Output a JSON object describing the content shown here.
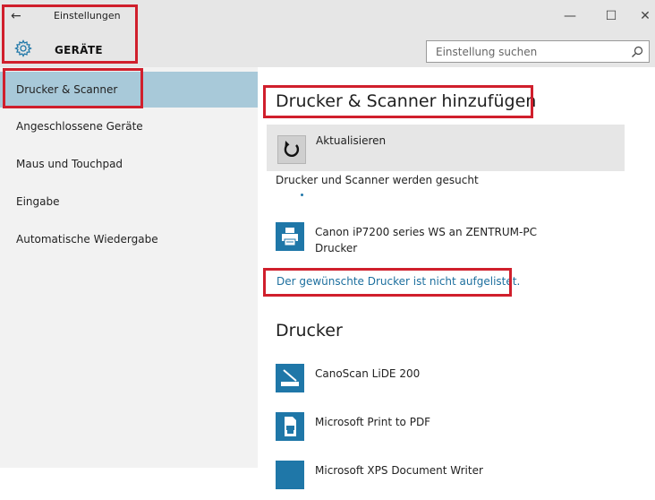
{
  "window": {
    "title": "Einstellungen",
    "back_glyph": "←",
    "minimize_glyph": "—",
    "maximize_glyph": "☐",
    "close_glyph": "✕"
  },
  "header": {
    "section_title": "GERÄTE",
    "search_placeholder": "Einstellung suchen"
  },
  "sidebar": {
    "items": [
      {
        "label": "Drucker & Scanner",
        "active": true
      },
      {
        "label": "Angeschlossene Geräte",
        "active": false
      },
      {
        "label": "Maus und Touchpad",
        "active": false
      },
      {
        "label": "Eingabe",
        "active": false
      },
      {
        "label": "Automatische Wiedergabe",
        "active": false
      }
    ]
  },
  "main": {
    "heading": "Drucker & Scanner hinzufügen",
    "refresh_label": "Aktualisieren",
    "searching_text": "Drucker und Scanner werden gesucht",
    "found_device": {
      "name": "Canon iP7200 series WS an ZENTRUM-PC",
      "type": "Drucker"
    },
    "not_listed_link": "Der gewünschte Drucker ist nicht aufgelistet.",
    "printers_heading": "Drucker",
    "printers": [
      {
        "name": "CanoScan LiDE 200",
        "icon": "scanner-icon"
      },
      {
        "name": "Microsoft Print to PDF",
        "icon": "pdf-printer-icon"
      },
      {
        "name": "Microsoft XPS Document Writer",
        "icon": "xps-printer-icon"
      }
    ]
  },
  "colors": {
    "accent": "#1f77a8",
    "sidebar_active": "#a8c9d9",
    "highlight_border": "#d01f2c",
    "link": "#1d6f9e"
  }
}
